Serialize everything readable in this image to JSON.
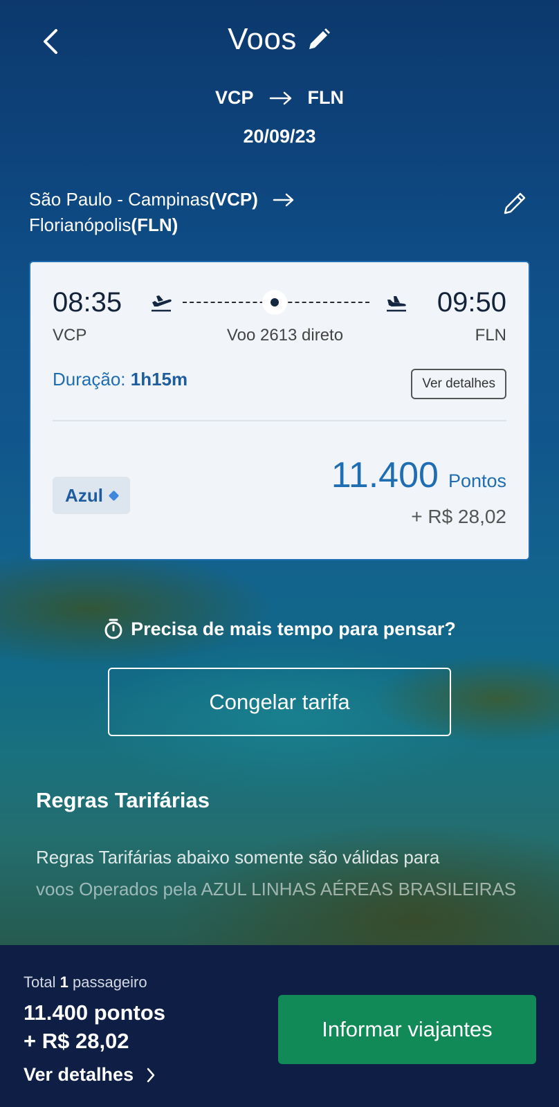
{
  "header": {
    "title": "Voos",
    "origin_code": "VCP",
    "destination_code": "FLN",
    "date": "20/09/23"
  },
  "route": {
    "origin_city": "São Paulo - Campinas",
    "origin_code": "(VCP)",
    "destination_city": "Florianópolis",
    "destination_code": "(FLN)"
  },
  "flight_card": {
    "departure_time": "08:35",
    "arrival_time": "09:50",
    "departure_code": "VCP",
    "arrival_code": "FLN",
    "flight_label": "Voo 2613 direto",
    "duration_label": "Duração:",
    "duration_value": "1h15m",
    "details_button": "Ver detalhes",
    "fare_badge": "Azul",
    "points_value": "11.400",
    "points_unit": "Pontos",
    "money_value": "+ R$ 28,02"
  },
  "freeze": {
    "question": "Precisa de mais tempo para pensar?",
    "button": "Congelar tarifa"
  },
  "rules": {
    "title": "Regras Tarifárias",
    "line1": "Regras Tarifárias abaixo somente são válidas para",
    "line2": "voos Operados pela AZUL LINHAS AÉREAS BRASILEIRAS"
  },
  "footer": {
    "total_prefix": "Total",
    "passenger_count": "1",
    "passenger_label": "passageiro",
    "total_points": "11.400 pontos",
    "total_money": "+ R$ 28,02",
    "details_link": "Ver detalhes",
    "cta_button": "Informar viajantes"
  },
  "colors": {
    "accent_blue": "#1f6db3",
    "cta_green": "#128a58",
    "footer_bg": "#0e1e44"
  }
}
